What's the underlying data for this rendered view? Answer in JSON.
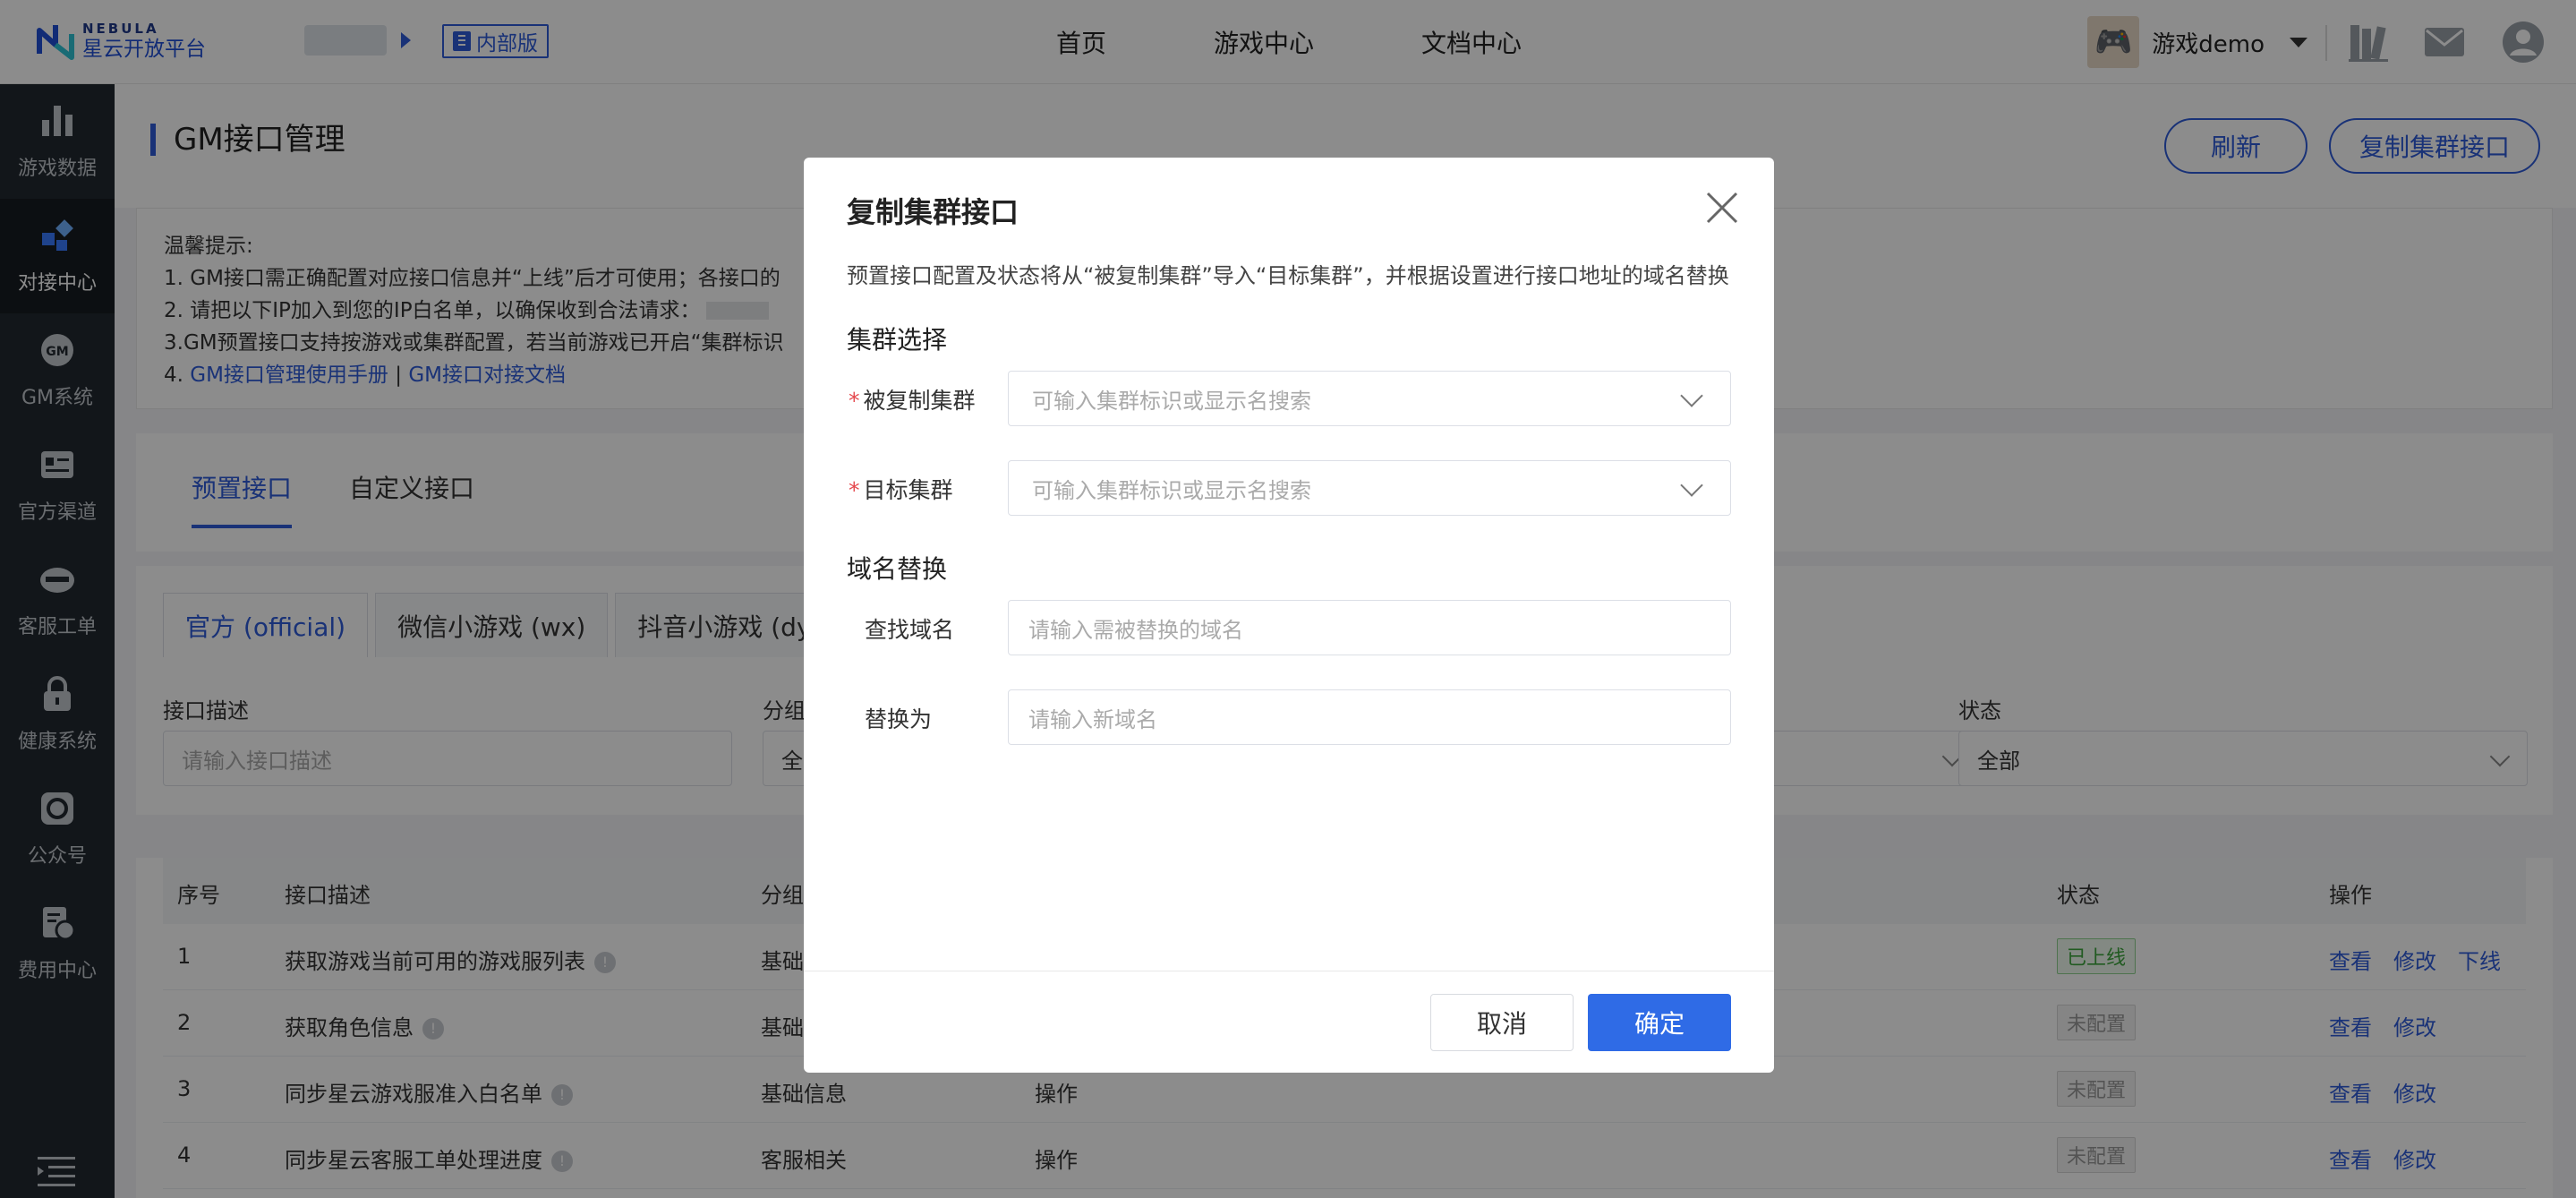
{
  "logo": {
    "en": "NEBULA",
    "cn": "星云开放平台"
  },
  "header": {
    "badge": "内部版",
    "nav": [
      "首页",
      "游戏中心",
      "文档中心"
    ],
    "user": {
      "avatar_emoji": "🎮",
      "name": "游戏demo"
    }
  },
  "sidebar": {
    "items": [
      {
        "label": "游戏数据",
        "icon": "bar-chart-icon"
      },
      {
        "label": "对接中心",
        "icon": "connect-icon",
        "active": true
      },
      {
        "label": "GM系统",
        "icon": "gm-icon"
      },
      {
        "label": "官方渠道",
        "icon": "id-card-icon"
      },
      {
        "label": "客服工单",
        "icon": "headset-icon"
      },
      {
        "label": "健康系统",
        "icon": "lock-icon"
      },
      {
        "label": "公众号",
        "icon": "wechat-official-icon"
      },
      {
        "label": "费用中心",
        "icon": "billing-icon"
      }
    ]
  },
  "page": {
    "title": "GM接口管理",
    "refresh_btn": "刷新",
    "copy_btn": "复制集群接口"
  },
  "tips": {
    "heading": "温馨提示:",
    "line1": "1. GM接口需正确配置对应接口信息并“上线”后才可使用；各接口的",
    "line2": "2. 请把以下IP加入到您的IP白名单，以确保收到合法请求：",
    "line3": "3.GM预置接口支持按游戏或集群配置，若当前游戏已开启“集群标识",
    "line4_prefix": "4. ",
    "link1": "GM接口管理使用手册",
    "link_sep": " | ",
    "link2": "GM接口对接文档"
  },
  "tabs": [
    "预置接口",
    "自定义接口"
  ],
  "channel_tabs": [
    "官方 (official)",
    "微信小游戏 (wx)",
    "抖音小游戏 (dy)"
  ],
  "filters": {
    "desc_label": "接口描述",
    "desc_placeholder": "请输入接口描述",
    "group_label": "分组",
    "group_value": "全",
    "status_label": "状态",
    "status_value": "全部"
  },
  "table": {
    "headers": {
      "no": "序号",
      "desc": "接口描述",
      "group": "分组",
      "status": "状态",
      "ops": "操作"
    },
    "rows": [
      {
        "no": "1",
        "desc": "获取游戏当前可用的游戏服列表",
        "group": "基础",
        "type": "",
        "status": "已上线",
        "status_kind": "on",
        "ops": [
          "查看",
          "修改",
          "下线"
        ]
      },
      {
        "no": "2",
        "desc": "获取角色信息",
        "group": "基础",
        "type": "",
        "status": "未配置",
        "status_kind": "off",
        "ops": [
          "查看",
          "修改"
        ]
      },
      {
        "no": "3",
        "desc": "同步星云游戏服准入白名单",
        "group": "基础信息",
        "type": "操作",
        "status": "未配置",
        "status_kind": "off",
        "ops": [
          "查看",
          "修改"
        ]
      },
      {
        "no": "4",
        "desc": "同步星云客服工单处理进度",
        "group": "客服相关",
        "type": "操作",
        "status": "未配置",
        "status_kind": "off",
        "ops": [
          "查看",
          "修改"
        ]
      }
    ]
  },
  "modal": {
    "title": "复制集群接口",
    "description": "预置接口配置及状态将从“被复制集群”导入“目标集群”，并根据设置进行接口地址的域名替换",
    "section_cluster": "集群选择",
    "source_label": "被复制集群",
    "source_placeholder": "可输入集群标识或显示名搜索",
    "target_label": "目标集群",
    "target_placeholder": "可输入集群标识或显示名搜索",
    "section_domain": "域名替换",
    "find_label": "查找域名",
    "find_placeholder": "请输入需被替换的域名",
    "replace_label": "替换为",
    "replace_placeholder": "请输入新域名",
    "cancel": "取消",
    "ok": "确定"
  },
  "colors": {
    "primary": "#2f5bd9",
    "ok_button": "#2f6be6",
    "sidebar_bg": "#212830",
    "status_on": "#3ca53c",
    "required": "#e5484d"
  }
}
